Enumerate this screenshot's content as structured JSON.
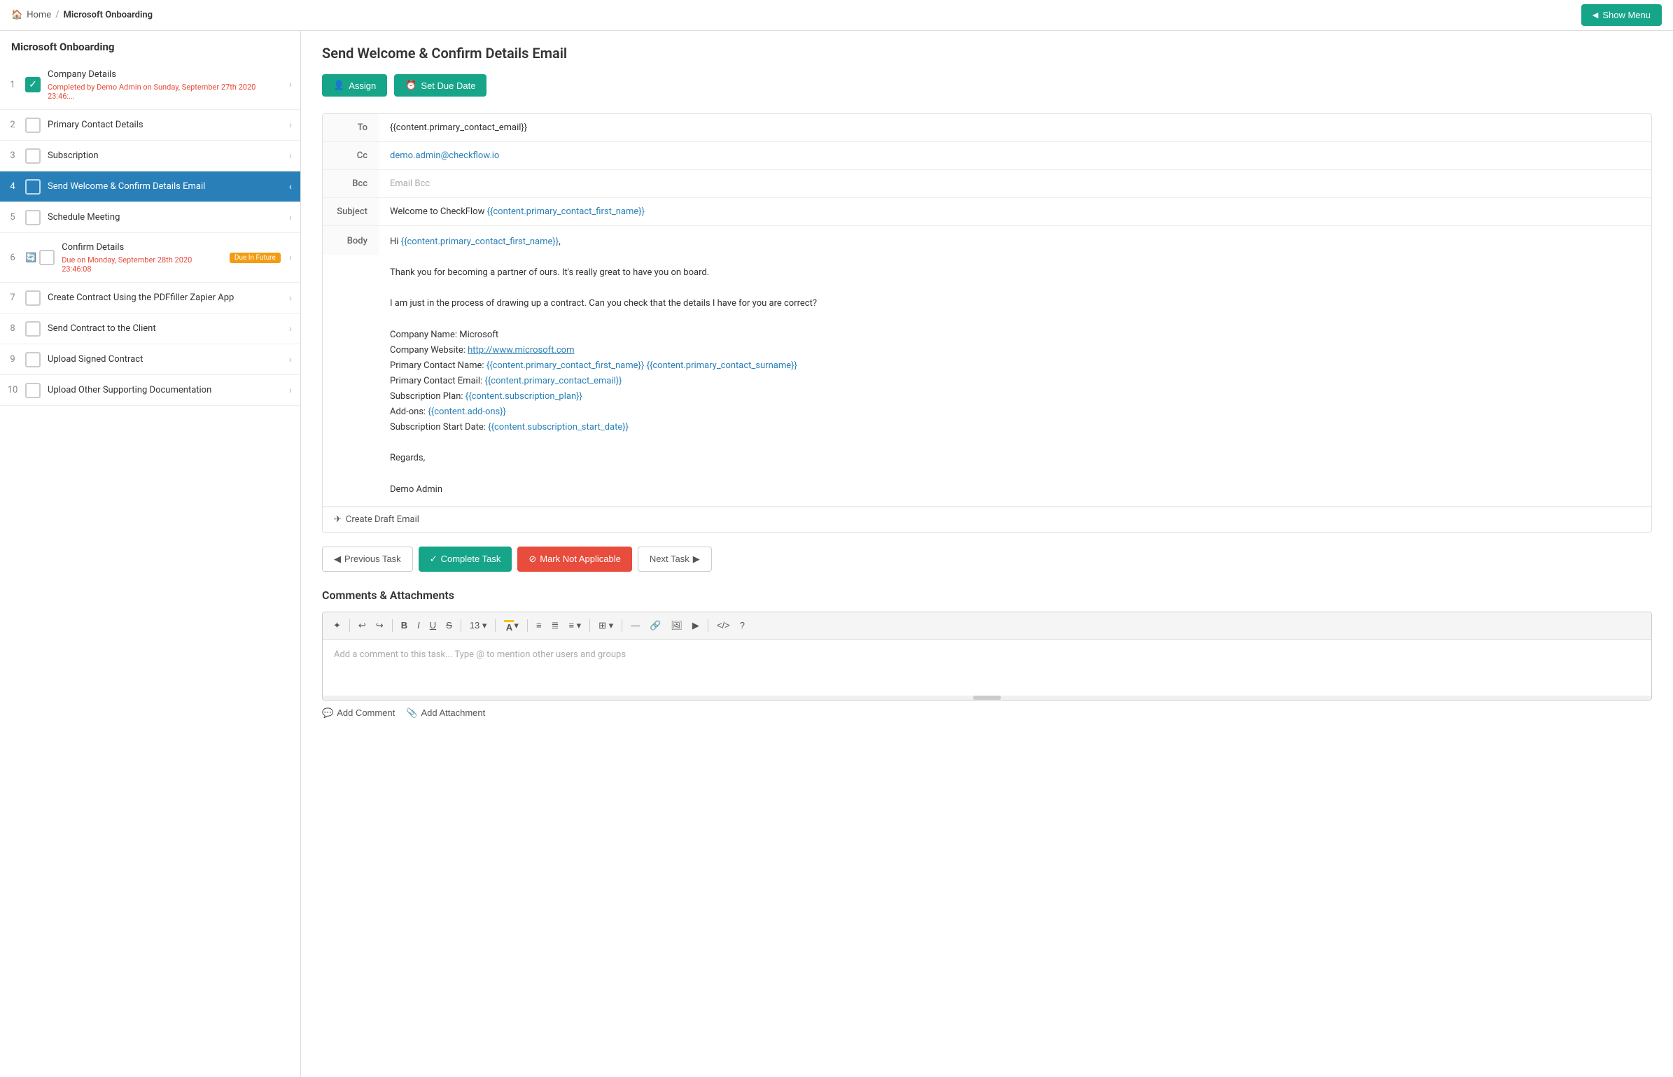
{
  "topBar": {
    "homeLabel": "Home",
    "separator": "/",
    "projectLabel": "Microsoft Onboarding",
    "showMenuLabel": "Show Menu"
  },
  "sidebar": {
    "title": "Microsoft Onboarding",
    "tasks": [
      {
        "num": 1,
        "name": "Company Details",
        "checked": true,
        "sub": "Completed by Demo Admin on Sunday, September 27th 2020 23:46:...",
        "subType": "completed",
        "badge": null,
        "active": false
      },
      {
        "num": 2,
        "name": "Primary Contact Details",
        "checked": false,
        "sub": null,
        "badge": null,
        "active": false
      },
      {
        "num": 3,
        "name": "Subscription",
        "checked": false,
        "sub": null,
        "badge": null,
        "active": false
      },
      {
        "num": 4,
        "name": "Send Welcome & Confirm Details Email",
        "checked": false,
        "sub": null,
        "badge": null,
        "active": true
      },
      {
        "num": 5,
        "name": "Schedule Meeting",
        "checked": false,
        "sub": null,
        "badge": null,
        "active": false
      },
      {
        "num": 6,
        "name": "Confirm Details",
        "checked": false,
        "sub": "Due on Monday, September 28th 2020 23:46:08",
        "subType": "overdue",
        "badge": "Due In Future",
        "badgeType": "future",
        "active": false,
        "hasClock": true
      },
      {
        "num": 7,
        "name": "Create Contract Using the PDFfiller Zapier App",
        "checked": false,
        "sub": null,
        "badge": null,
        "active": false
      },
      {
        "num": 8,
        "name": "Send Contract to the Client",
        "checked": false,
        "sub": null,
        "badge": null,
        "active": false
      },
      {
        "num": 9,
        "name": "Upload Signed Contract",
        "checked": false,
        "sub": null,
        "badge": null,
        "active": false
      },
      {
        "num": 10,
        "name": "Upload Other Supporting Documentation",
        "checked": false,
        "sub": null,
        "badge": null,
        "active": false
      }
    ]
  },
  "content": {
    "pageTitle": "Send Welcome & Confirm Details Email",
    "assignLabel": "Assign",
    "setDueDateLabel": "Set Due Date",
    "email": {
      "toLabel": "To",
      "toValue": "{{content.primary_contact_email}}",
      "ccLabel": "Cc",
      "ccValue": "demo.admin@checkflow.io",
      "bccLabel": "Bcc",
      "bccPlaceholder": "Email Bcc",
      "subjectLabel": "Subject",
      "subjectValue": "Welcome to CheckFlow {{content.primary_contact_first_name}}",
      "bodyLabel": "Body",
      "bodyLines": [
        "Hi {{content.primary_contact_first_name}},",
        "",
        "Thank you for becoming a partner of ours. It's really great to have you on board.",
        "",
        "I am just in the process of drawing up a contract. Can you check that the details I have for you are correct?",
        "",
        "Company Name: Microsoft",
        "Company Website: http://www.microsoft.com",
        "Primary Contact Name: {{content.primary_contact_first_name}} {{content.primary_contact_surname}}",
        "Primary Contact Email: {{content.primary_contact_email}}",
        "Subscription Plan: {{content.subscription_plan}}",
        "Add-ons: {{content.add-ons}}",
        "Subscription Start Date: {{content.subscription_start_date}}",
        "",
        "Regards,",
        "",
        "Demo Admin"
      ],
      "createDraftLabel": "Create Draft Email"
    },
    "nav": {
      "prevLabel": "Previous Task",
      "completeLabel": "Complete Task",
      "notApplicableLabel": "Mark Not Applicable",
      "nextLabel": "Next Task"
    },
    "comments": {
      "title": "Comments & Attachments",
      "placeholder": "Add a comment to this task... Type @ to mention other users and groups",
      "addCommentLabel": "Add Comment",
      "addAttachmentLabel": "Add Attachment",
      "toolbar": {
        "magic": "✦",
        "undo": "↩",
        "redo": "↪",
        "bold": "B",
        "italic": "I",
        "underline": "U",
        "strike": "S",
        "fontSize": "13",
        "fontColor": "A",
        "bulletList": "≡",
        "numberedList": "≣",
        "align": "≡",
        "table": "⊞",
        "hr": "—",
        "link": "🔗",
        "image": "🖼",
        "video": "▶",
        "code": "</>",
        "help": "?"
      }
    }
  }
}
